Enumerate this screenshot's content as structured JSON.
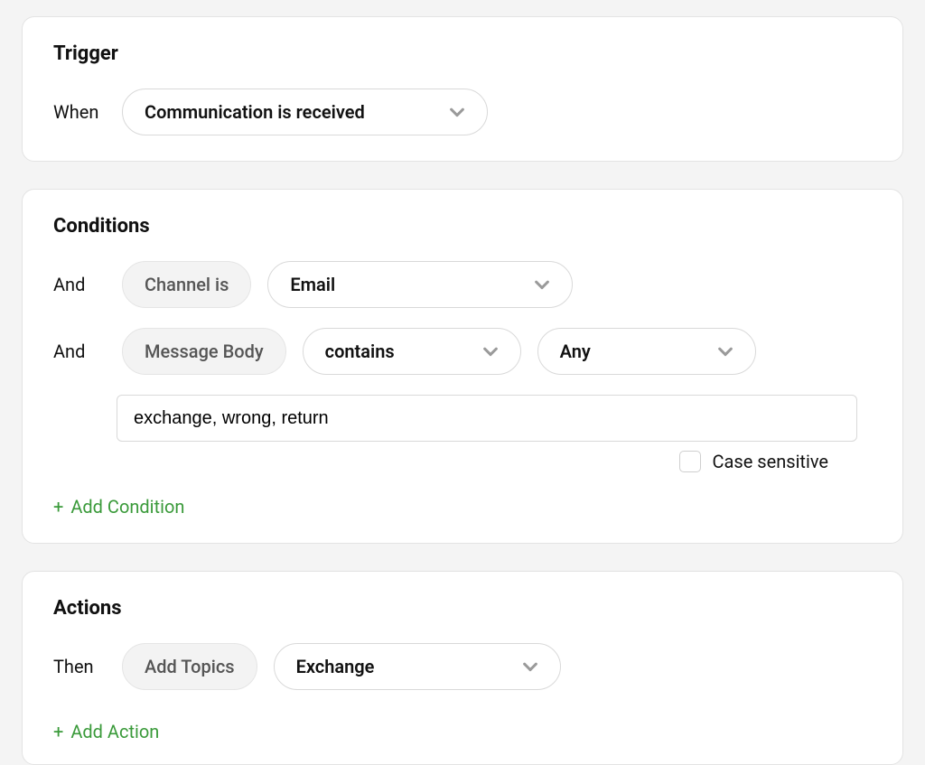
{
  "trigger": {
    "title": "Trigger",
    "whenLabel": "When",
    "selected": "Communication is received"
  },
  "conditions": {
    "title": "Conditions",
    "andLabel": "And",
    "rows": [
      {
        "tag": "Channel is",
        "value": "Email"
      },
      {
        "tag": "Message Body",
        "op": "contains",
        "mode": "Any",
        "input": "exchange, wrong, return"
      }
    ],
    "caseSensitiveLabel": "Case sensitive",
    "addLabel": "Add Condition"
  },
  "actions": {
    "title": "Actions",
    "thenLabel": "Then",
    "tag": "Add Topics",
    "value": "Exchange",
    "addLabel": "Add Action"
  }
}
